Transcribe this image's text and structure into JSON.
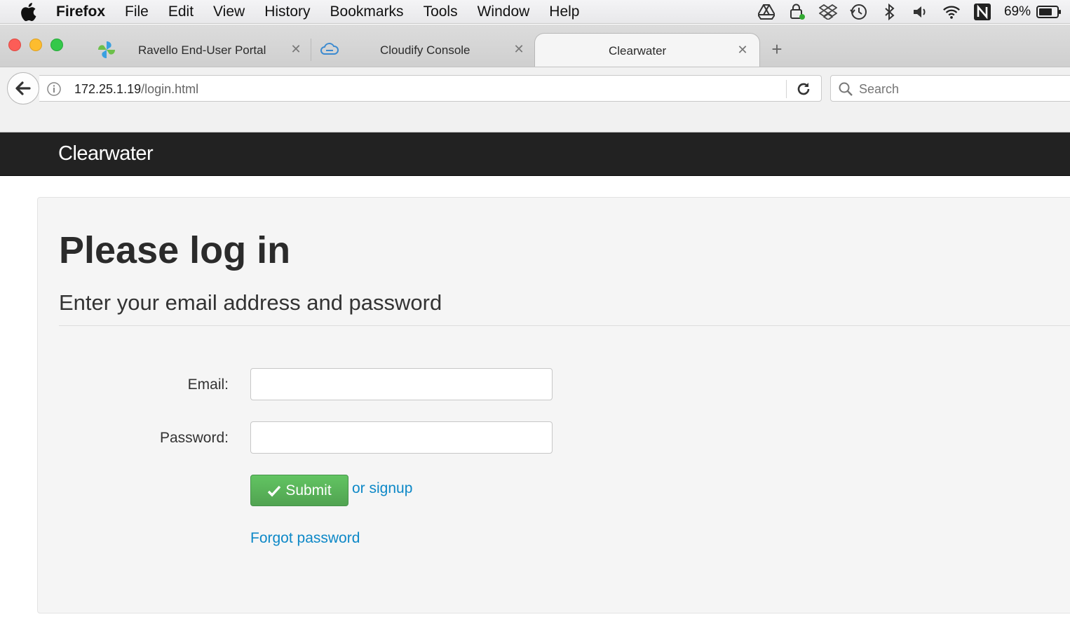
{
  "menubar": {
    "app_name": "Firefox",
    "items": [
      "File",
      "Edit",
      "View",
      "History",
      "Bookmarks",
      "Tools",
      "Window",
      "Help"
    ],
    "battery": "69%"
  },
  "tabs": [
    {
      "label": "Ravello End-User Portal",
      "icon": "pinwheel-icon",
      "active": false
    },
    {
      "label": "Cloudify Console",
      "icon": "cloud-icon",
      "active": false
    },
    {
      "label": "Clearwater",
      "icon": "",
      "active": true
    }
  ],
  "tab_close_glyph": "✕",
  "new_tab_glyph": "+",
  "navbar": {
    "url_host": "172.25.1.19",
    "url_path": "/login.html",
    "search_placeholder": "Search"
  },
  "header": {
    "brand": "Clearwater"
  },
  "login": {
    "title": "Please log in",
    "subtitle": "Enter your email address and password",
    "email_label": "Email:",
    "email_value": "",
    "password_label": "Password:",
    "password_value": "",
    "submit_label": "Submit",
    "signup_link": "or signup",
    "forgot_link": "Forgot password"
  },
  "colors": {
    "header_bg": "#222222",
    "submit_green": "#5bb75b",
    "link_blue": "#0d88c7"
  }
}
